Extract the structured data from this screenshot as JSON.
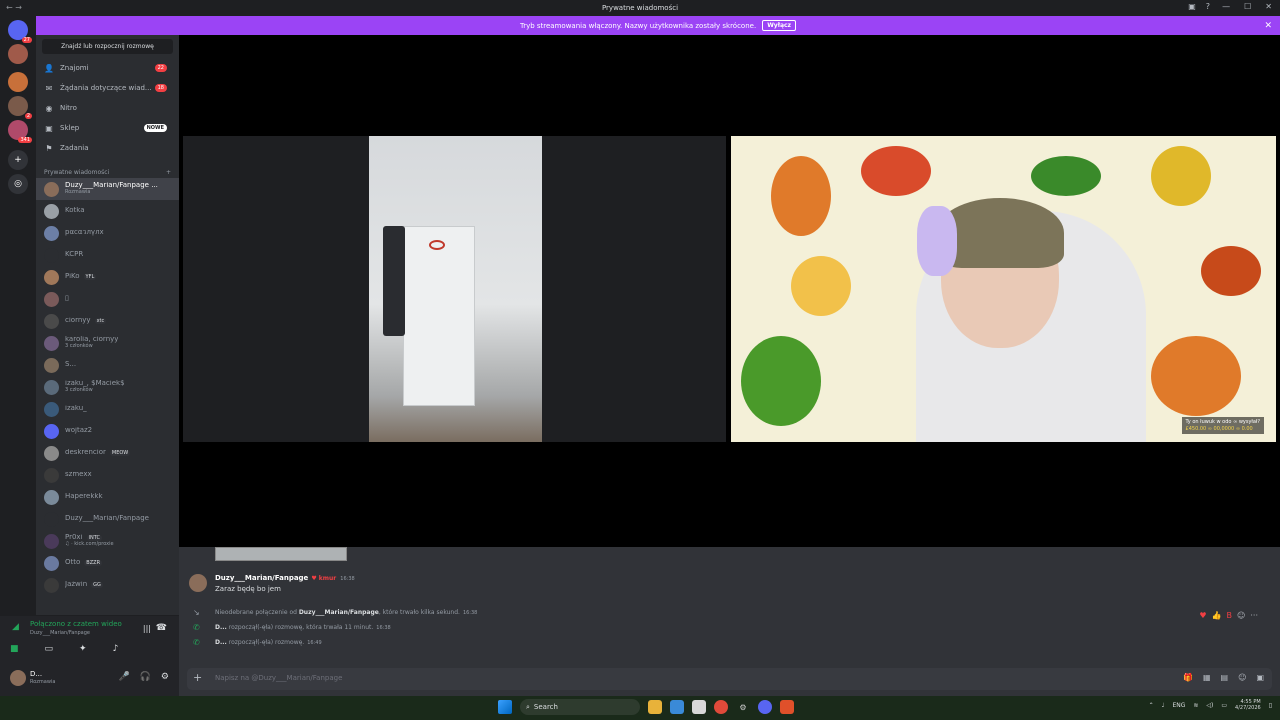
{
  "window": {
    "title": "Prywatne wiadomości",
    "back": "←",
    "forward": "→",
    "min": "—",
    "max": "☐",
    "close": "✕"
  },
  "banner": {
    "text": "Tryb streamowania włączony. Nazwy użytkownika zostały skrócone.",
    "button": "Wyłącz",
    "close": "✕"
  },
  "servers": [
    {
      "label": "",
      "badge": "27"
    },
    {
      "label": "",
      "badge": ""
    },
    {
      "label": "",
      "badge": ""
    },
    {
      "label": "",
      "badge": "2"
    },
    {
      "label": "",
      "badge": "341"
    },
    {
      "label": "+",
      "badge": ""
    },
    {
      "label": "◎",
      "badge": ""
    }
  ],
  "sidebar": {
    "search_placeholder": "Znajdź lub rozpocznij rozmowę",
    "nav": [
      {
        "label": "Znajomi",
        "icon": "friends-icon",
        "count": "22"
      },
      {
        "label": "Żądania dotyczące wiad...",
        "icon": "mail-icon",
        "count": "18"
      },
      {
        "label": "Nitro",
        "icon": "nitro-icon",
        "count": ""
      },
      {
        "label": "Sklep",
        "icon": "shop-icon",
        "new": "NOWE"
      },
      {
        "label": "Zadania",
        "icon": "quests-icon",
        "count": ""
      }
    ],
    "dm_header": "Prywatne wiadomości",
    "dm_add": "+",
    "dms": [
      {
        "name": "Duzy___Marian/Fanpage ...",
        "sub": "Rozmawia",
        "tag": "",
        "color": "#8a6d5a",
        "active": true
      },
      {
        "name": "Kotka",
        "sub": "",
        "tag": "",
        "color": "#9aa0a6"
      },
      {
        "name": "pαcαวлγлx",
        "sub": "",
        "tag": "",
        "color": "#6c7fa6"
      },
      {
        "name": "KCPR",
        "sub": "",
        "tag": "",
        "color": "#2b2d31"
      },
      {
        "name": "PiKo",
        "sub": "",
        "tag": "YFL",
        "color": "#a0785a"
      },
      {
        "name": "▯",
        "sub": "",
        "tag": "",
        "color": "#7a5a5a"
      },
      {
        "name": "ciornyy",
        "sub": "",
        "tag": "xtc",
        "color": "#4a4a4a"
      },
      {
        "name": "karolia, ciornyy",
        "sub": "3 członków",
        "tag": "",
        "color": "#6b5a7a"
      },
      {
        "name": "S...",
        "sub": "",
        "tag": "",
        "color": "#7a6a5a"
      },
      {
        "name": "izaku_, $Maciek$",
        "sub": "3 członków",
        "tag": "",
        "color": "#5a6a7a"
      },
      {
        "name": "izaku_",
        "sub": "",
        "tag": "",
        "color": "#3a5a7a"
      },
      {
        "name": "wojtaz2",
        "sub": "",
        "tag": "",
        "color": "#5865f2"
      },
      {
        "name": "deskrencior",
        "sub": "",
        "tag": "MEOW",
        "color": "#8a8a8a"
      },
      {
        "name": "szmexx",
        "sub": "",
        "tag": "",
        "color": "#3a3a3a"
      },
      {
        "name": "Haperekkk",
        "sub": "",
        "tag": "",
        "color": "#7a8a9a"
      },
      {
        "name": "Duzy___Marian/Fanpage",
        "sub": "",
        "tag": "",
        "color": "#2b2d31"
      },
      {
        "name": "Pr0xi",
        "sub": "♫ · kick.com/proxie",
        "tag": "INTC",
        "color": "#4a3a5a"
      },
      {
        "name": "Otto",
        "sub": "",
        "tag": "BZZR",
        "color": "#6a7aa0"
      },
      {
        "name": "Jażwin",
        "sub": "",
        "tag": "GG",
        "color": "#3a3a3a"
      }
    ]
  },
  "voice": {
    "status": "Połączono z czatem wideo",
    "server": "Duzy___Marian/Fanpage"
  },
  "user": {
    "name": "D...",
    "status": "Rozmawia"
  },
  "chat": {
    "author": "Duzy___Marian/Fanpage",
    "author_badge": "♥ kmur",
    "time": "16:38",
    "message": "Zaraz będę bo jem",
    "system": [
      {
        "icon": "↘",
        "pre": "Nieodebrane połączenie od ",
        "bold": "Duzy___Marian/Fanpage",
        "post": ", które trwało kilka sekund.",
        "time": "16:38",
        "color": "#949ba4"
      },
      {
        "icon": "✆",
        "pre": "",
        "bold": "D...",
        "post": " rozpoczął(-ęła) rozmowę, która trwała 11 minut.",
        "time": "16:38",
        "color": "#23a55a"
      },
      {
        "icon": "✆",
        "pre": "",
        "bold": "D...",
        "post": " rozpoczął(-ęła) rozmowę.",
        "time": "16:49",
        "color": "#23a55a"
      }
    ],
    "input_placeholder": "Napisz na @Duzy___Marian/Fanpage",
    "reactions": [
      "♥",
      "👍",
      "B",
      "☺",
      "···"
    ]
  },
  "stream_overlay": {
    "line1": "Ty on łuwuk w odo ∞ wysyłał?",
    "line2": "£450.00 ∞ 00,0000 ∞ 0.00"
  },
  "taskbar": {
    "search": "Search",
    "lang": "ENG",
    "time": "4:55 PM",
    "date": "4/27/2026"
  }
}
